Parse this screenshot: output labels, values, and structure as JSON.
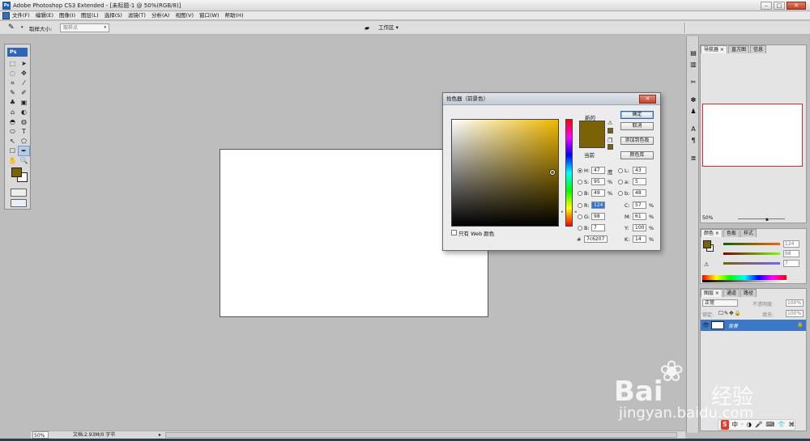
{
  "window": {
    "title": "Adobe Photoshop CS3 Extended - [未标题-1 @ 50%(RGB/8)]",
    "app_logo": "Ps",
    "minimize": "–",
    "maximize": "□",
    "close": "✕"
  },
  "menu": {
    "items": [
      "文件(F)",
      "编辑(E)",
      "图像(I)",
      "图层(L)",
      "选择(S)",
      "滤镜(T)",
      "分析(A)",
      "视图(V)",
      "窗口(W)",
      "帮助(H)"
    ]
  },
  "options_bar": {
    "tool_icon": "eyedropper-icon",
    "sample_size_label": "取样大小:",
    "sample_size_value": "取样点",
    "workspace_label": "工作区 ▾"
  },
  "toolbox": {
    "badge": "Ps",
    "tools": [
      "⬚",
      "➤",
      "◌",
      "✥",
      "⌗",
      "⁄",
      "✎",
      "✐",
      "♣",
      "▣",
      "⌂",
      "◐",
      "◓",
      "◍",
      "⬭",
      "T",
      "↖",
      "⬠",
      "☐",
      "✒",
      "✋",
      "🔍"
    ]
  },
  "status_bar": {
    "zoom": "50%",
    "doc_info": "文档:2.93M/0 字节",
    "arrow": "▸"
  },
  "color_picker": {
    "title": "拾色器（前景色）",
    "close": "✕",
    "new_label": "新的",
    "current_label": "当前",
    "new_color": "#7c6207",
    "current_color": "#7c6207",
    "buttons": {
      "ok": "确定",
      "cancel": "取消",
      "add_swatch": "添加到色板",
      "libraries": "颜色库"
    },
    "web_only_label": "只有 Web 颜色",
    "fields": {
      "H": {
        "label": "H:",
        "value": "47",
        "unit": "度"
      },
      "S": {
        "label": "S:",
        "value": "95",
        "unit": "%"
      },
      "B": {
        "label": "B:",
        "value": "49",
        "unit": "%"
      },
      "R": {
        "label": "R:",
        "value": "124"
      },
      "G": {
        "label": "G:",
        "value": "98"
      },
      "Bb": {
        "label": "B:",
        "value": "7"
      },
      "L": {
        "label": "L:",
        "value": "43"
      },
      "a": {
        "label": "a:",
        "value": "5"
      },
      "b": {
        "label": "b:",
        "value": "48"
      },
      "C": {
        "label": "C:",
        "value": "57",
        "unit": "%"
      },
      "M": {
        "label": "M:",
        "value": "61",
        "unit": "%"
      },
      "Y": {
        "label": "Y:",
        "value": "100",
        "unit": "%"
      },
      "K": {
        "label": "K:",
        "value": "14",
        "unit": "%"
      }
    },
    "hex_label": "#",
    "hex_value": "7c6207",
    "warning_icon": "⚠",
    "cube_icon": "❒"
  },
  "panels": {
    "navigator": {
      "tabs": [
        "导航器 ×",
        "直方图",
        "信息"
      ],
      "zoom": "50%"
    },
    "color": {
      "tabs": [
        "颜色 ×",
        "色板",
        "样式"
      ],
      "rows": [
        {
          "label": "",
          "value": "124",
          "bar": "linear-gradient(to right, #0c6207, #ff6207)"
        },
        {
          "label": "",
          "value": "98",
          "bar": "linear-gradient(to right, #7c0007, #7cff07)"
        },
        {
          "label": "",
          "value": "7",
          "bar": "linear-gradient(to right, #7c6200, #7c62ff)"
        }
      ],
      "warning_icon": "⚠"
    },
    "layers": {
      "tabs": [
        "图层 ×",
        "通道",
        "路径"
      ],
      "blend_mode": "正常",
      "opacity_label": "不透明度:",
      "opacity_value": "100%",
      "lock_label": "锁定:",
      "lock_icons": "☐✎✥🔒",
      "fill_label": "填充:",
      "fill_value": "100%",
      "layer_name": "背景",
      "eye_icon": "👁",
      "lock_icon": "🔒"
    }
  },
  "watermark": {
    "brand": "Bai",
    "brand_cn": "经验",
    "url": "jingyan.baidu.com"
  },
  "ime": [
    "S",
    "中",
    "·",
    "◑",
    "🎤",
    "⌨",
    "👕",
    "⌘"
  ]
}
